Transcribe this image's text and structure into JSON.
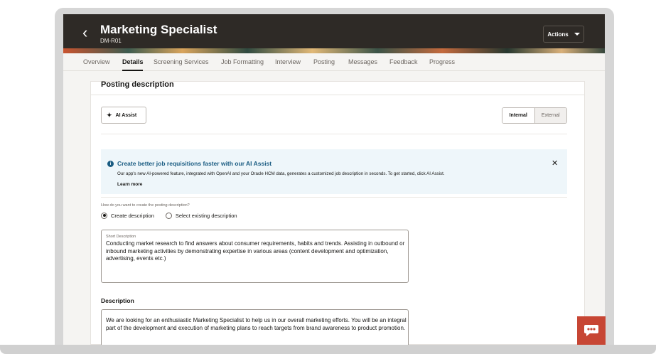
{
  "header": {
    "title": "Marketing Specialist",
    "subtitle": "DM-R01",
    "actions_label": "Actions"
  },
  "tabs": [
    {
      "label": "Overview"
    },
    {
      "label": "Details"
    },
    {
      "label": "Screening Services"
    },
    {
      "label": "Job Formatting"
    },
    {
      "label": "Interview"
    },
    {
      "label": "Posting"
    },
    {
      "label": "Messages"
    },
    {
      "label": "Feedback"
    },
    {
      "label": "Progress"
    }
  ],
  "active_tab": "Details",
  "section": {
    "title": "Posting description",
    "ai_assist_label": "AI Assist",
    "toggle": {
      "internal": "Internal",
      "external": "External",
      "selected": "Internal"
    }
  },
  "notice": {
    "title": "Create better job requisitions faster with our AI Assist",
    "text": "Our app's new AI-powered feature, integrated with OpenAI and your Oracle HCM data, generates a customized job description in seconds. To get started, click AI Assist.",
    "link": "Learn more"
  },
  "question": {
    "label": "How do you want to create the posting description?",
    "options": [
      "Create description",
      "Select existing description"
    ],
    "selected": "Create description"
  },
  "short_description": {
    "label": "Short Description",
    "value": "Conducting market research to find answers about consumer requirements, habits and trends. Assisting in outbound or inbound marketing activities by demonstrating expertise in various areas (content development and optimization, advertising, events etc.)"
  },
  "description": {
    "label": "Description",
    "value": "We are looking for an enthusiastic Marketing Specialist to help us in our overall marketing efforts. You will be an integral part of the development and execution of marketing plans to reach targets from brand awareness to product promotion."
  },
  "colors": {
    "header_bg": "#2e2a26",
    "accent_link": "#1a5c82",
    "chat_button": "#c74634"
  },
  "icons": {
    "back": "chevron-left-icon",
    "ai": "sparkle-icon",
    "info": "info-icon",
    "close": "close-icon",
    "chat": "chat-icon"
  }
}
